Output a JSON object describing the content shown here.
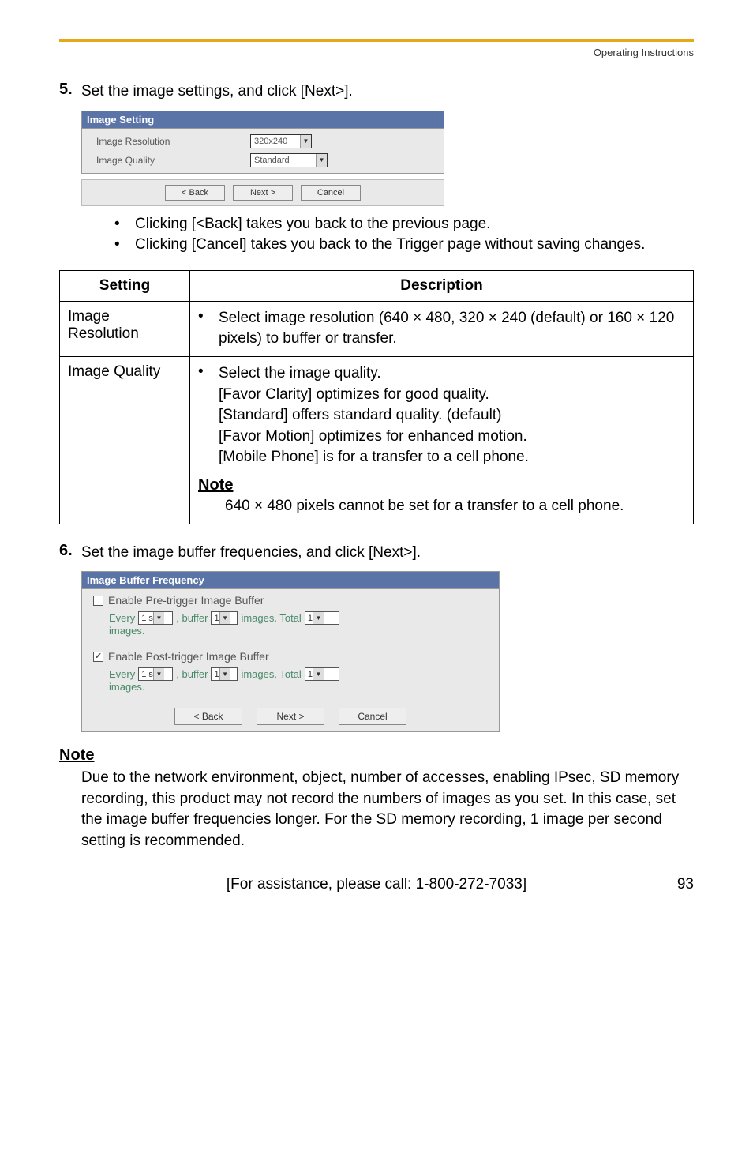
{
  "header": {
    "doc_title": "Operating Instructions"
  },
  "step5": {
    "num": "5.",
    "text": "Set the image settings, and click [Next>].",
    "panel_title": "Image Setting",
    "row1_label": "Image Resolution",
    "row1_value": "320x240",
    "row2_label": "Image Quality",
    "row2_value": "Standard",
    "btn_back": "< Back",
    "btn_next": "Next >",
    "btn_cancel": "Cancel",
    "note1": "Clicking [<Back] takes you back to the previous page.",
    "note2": "Clicking [Cancel] takes you back to the Trigger page without saving changes."
  },
  "table": {
    "h1": "Setting",
    "h2": "Description",
    "r1c1": "Image Resolution",
    "r1c2": "Select image resolution (640 × 480, 320 × 240 (default) or 160 × 120 pixels) to buffer or transfer.",
    "r2c1": "Image Quality",
    "r2_b1": "Select the image quality.",
    "r2_l2": "[Favor Clarity] optimizes for good quality.",
    "r2_l3": "[Standard] offers standard quality. (default)",
    "r2_l4": "[Favor Motion] optimizes for enhanced motion.",
    "r2_l5": "[Mobile Phone] is for a transfer to a cell phone.",
    "r2_note_h": "Note",
    "r2_note_b": "640 × 480 pixels cannot be set for a transfer to a cell phone."
  },
  "step6": {
    "num": "6.",
    "text": "Set the image buffer frequencies, and click [Next>].",
    "panel_title": "Image Buffer Frequency",
    "pre_label": "Enable Pre-trigger Image Buffer",
    "post_label": "Enable Post-trigger Image Buffer",
    "line_every": "Every",
    "sel_interval": "1 s",
    "line_buf": ", buffer",
    "sel_count": "1",
    "line_images_total": "images. Total",
    "sel_total": "1",
    "line_images_end": "images.",
    "btn_back": "< Back",
    "btn_next": "Next >",
    "btn_cancel": "Cancel"
  },
  "bottom_note": {
    "heading": "Note",
    "body": "Due to the network environment, object, number of accesses, enabling IPsec, SD memory recording, this product may not record the numbers of images as you set. In this case, set the image buffer frequencies longer. For the SD memory recording, 1 image per second setting is recommended."
  },
  "footer": {
    "assist": "[For assistance, please call: 1-800-272-7033]",
    "page": "93"
  }
}
